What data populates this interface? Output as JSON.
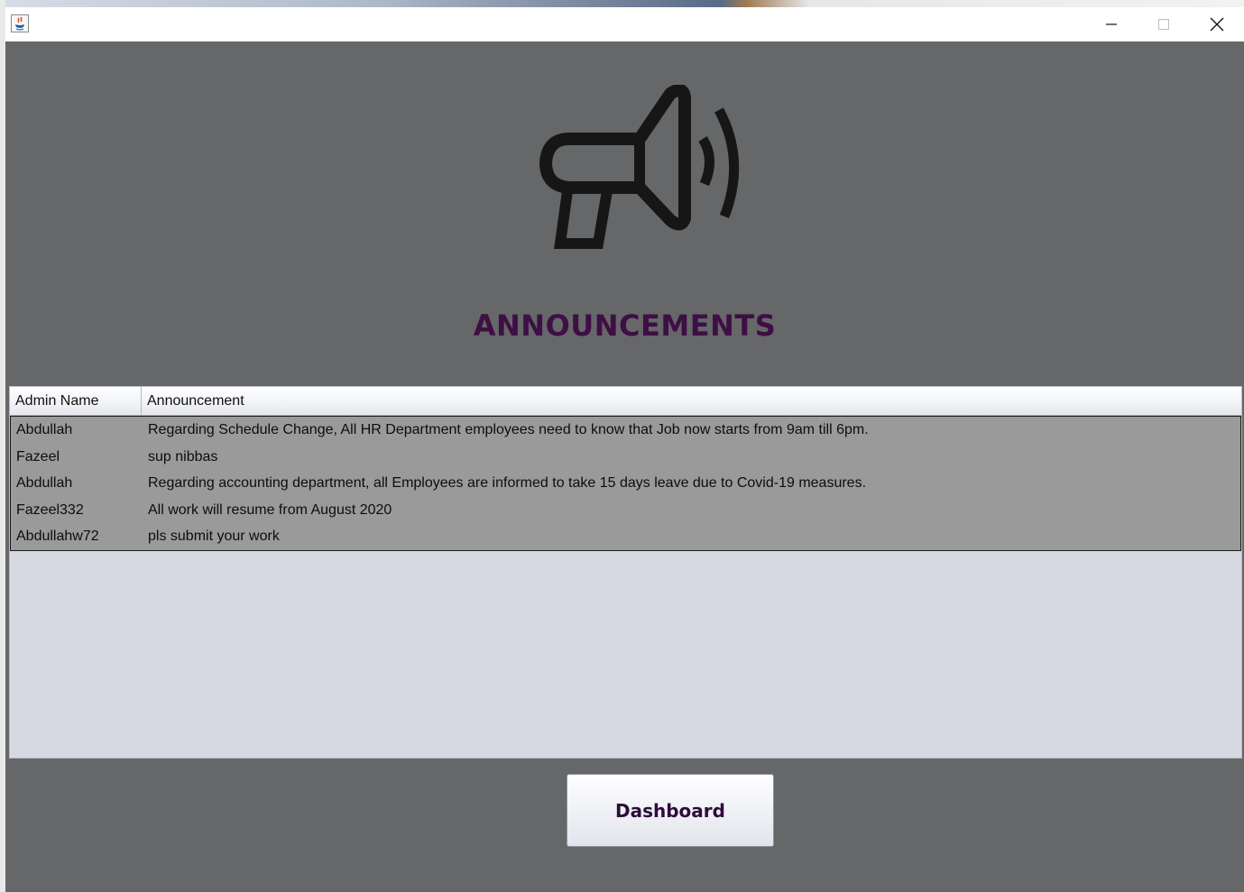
{
  "window": {
    "app_icon": "java-icon",
    "controls": {
      "minimize": "minimize-icon",
      "maximize": "maximize-icon",
      "close": "close-icon"
    }
  },
  "header": {
    "icon": "megaphone-icon",
    "title": "ANNOUNCEMENTS",
    "title_color": "#3e0f44"
  },
  "table": {
    "columns": [
      "Admin Name",
      "Announcement"
    ],
    "rows": [
      {
        "admin": "Abdullah",
        "announcement": "Regarding Schedule Change, All HR Department employees need to know that Job now starts from 9am till 6pm."
      },
      {
        "admin": "Fazeel",
        "announcement": "sup nibbas"
      },
      {
        "admin": "Abdullah",
        "announcement": "Regarding accounting department, all Employees are informed to take 15 days leave due to Covid-19 measures."
      },
      {
        "admin": "Fazeel332",
        "announcement": "All work will resume from August 2020"
      },
      {
        "admin": "Abdullahw72",
        "announcement": "pls submit your work"
      }
    ]
  },
  "footer": {
    "dashboard_label": "Dashboard"
  },
  "colors": {
    "background": "#666768",
    "table_selected_rows": "#9a9a9a",
    "table_empty_area": "#d6d9e1"
  }
}
